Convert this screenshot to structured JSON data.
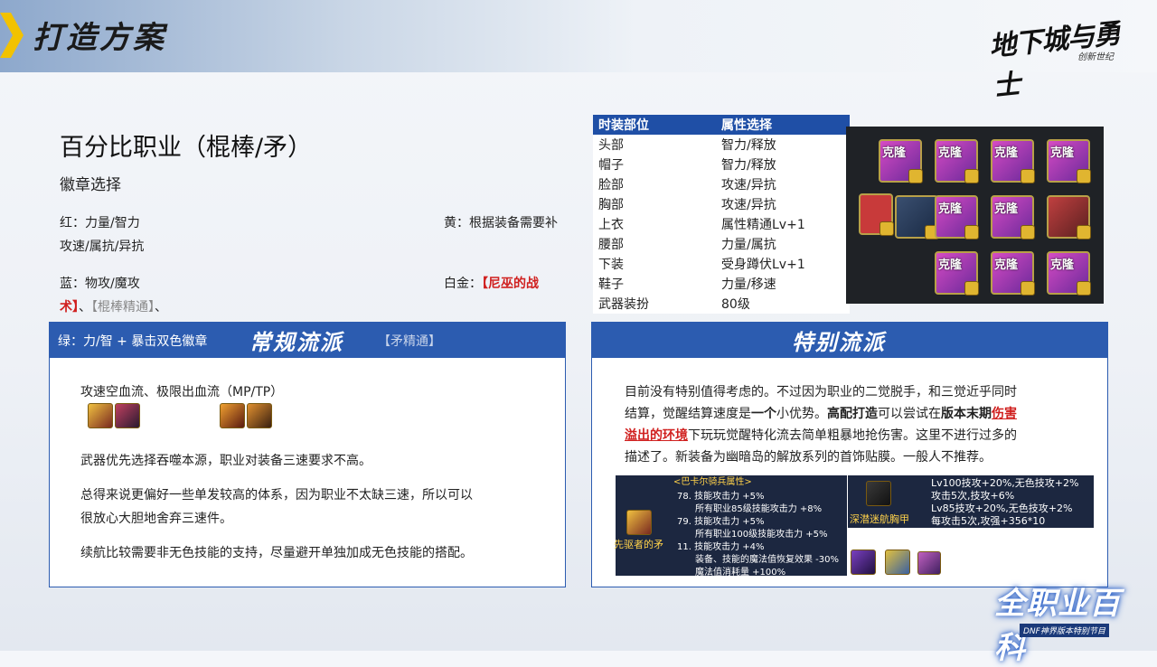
{
  "header": {
    "title": "打造方案",
    "logo_text": "地下城与勇士",
    "logo_sub": "创新世纪"
  },
  "main_title": "百分比职业（棍棒/矛）",
  "badge_section": {
    "title": "徽章选择",
    "red": "红：力量/智力",
    "red2": "攻速/属抗/异抗",
    "yellow": "黄：根据装备需要补",
    "blue": "蓝：物攻/魔攻",
    "platinum_label": "白金：",
    "platinum_red1": "【尼巫的战",
    "platinum_red2": "术】",
    "platinum_sep1": "、",
    "platinum_gray1": "【棍棒精通】",
    "platinum_sep2": "、",
    "green": "绿：力/智 + 暴击双色徽章",
    "platinum_gray2": "【矛精通】"
  },
  "fashion_table": {
    "headers": [
      "时装部位",
      "属性选择"
    ],
    "rows": [
      [
        "头部",
        "智力/释放"
      ],
      [
        "帽子",
        "智力/释放"
      ],
      [
        "脸部",
        "攻速/异抗"
      ],
      [
        "胸部",
        "攻速/异抗"
      ],
      [
        "上衣",
        "属性精通Lv+1"
      ],
      [
        "腰部",
        "力量/属抗"
      ],
      [
        "下装",
        "受身蹲伏Lv+1"
      ],
      [
        "鞋子",
        "力量/移速"
      ],
      [
        "武器装扮",
        "80级"
      ]
    ]
  },
  "icon_grid": {
    "tag": "克隆"
  },
  "panel_left": {
    "title": "常规流派",
    "line1": "攻速空血流、极限出血流（MP/TP）",
    "para1": "武器优先选择吞噬本源，职业对装备三速要求不高。",
    "para2a": "总得来说更偏好一些单发较高的体系，因为职业不太缺三速，所以可以",
    "para2b": "很放心大胆地舍弃三速件。",
    "para3": "续航比较需要非无色技能的支持，尽量避开单独加成无色技能的搭配。"
  },
  "panel_right": {
    "title": "特别流派",
    "l1": "目前没有特别值得考虑的。不过因为职业的二觉脱手，和三觉近乎同时",
    "l2a": "结算，觉醒结算速度是",
    "l2b": "一个",
    "l2c": "小优势。",
    "l2d": "高配打造",
    "l2e": "可以尝试在",
    "l2f": "版本末期",
    "l2g": "伤害",
    "l3a": "溢出的环境",
    "l3b": "下玩玩觉醒特化流去简单粗暴地抢伤害。这里不进行过多的",
    "l4": "描述了。新装备为幽暗岛的解放系列的首饰贴膜。一般人不推荐。"
  },
  "item_box": {
    "header": "<巴卡尔骑兵属性>",
    "name": "先驱者的矛",
    "lines": [
      "78. 技能攻击力 +5%",
      "所有职业85级技能攻击力 +8%",
      "79. 技能攻击力 +5%",
      "所有职业100级技能攻击力 +5%",
      "11. 技能攻击力 +4%",
      "装备、技能的魔法值恢复效果 -30%",
      "魔法值消耗量 +100%"
    ]
  },
  "item2": {
    "name": "深潜迷航胸甲",
    "lines": [
      "Lv100技攻+20%,无色技攻+2%",
      "攻击5次,技攻+6%",
      "Lv85技攻+20%,无色技攻+2%",
      "每攻击5次,攻强+356*10"
    ]
  },
  "corner_badge": {
    "title": "全职业百科",
    "sub": "DNF神界版本特别节目"
  },
  "colors": {
    "primary": "#2c5cb0",
    "table_header": "#1f4fa6",
    "accent_red": "#d0201f"
  }
}
